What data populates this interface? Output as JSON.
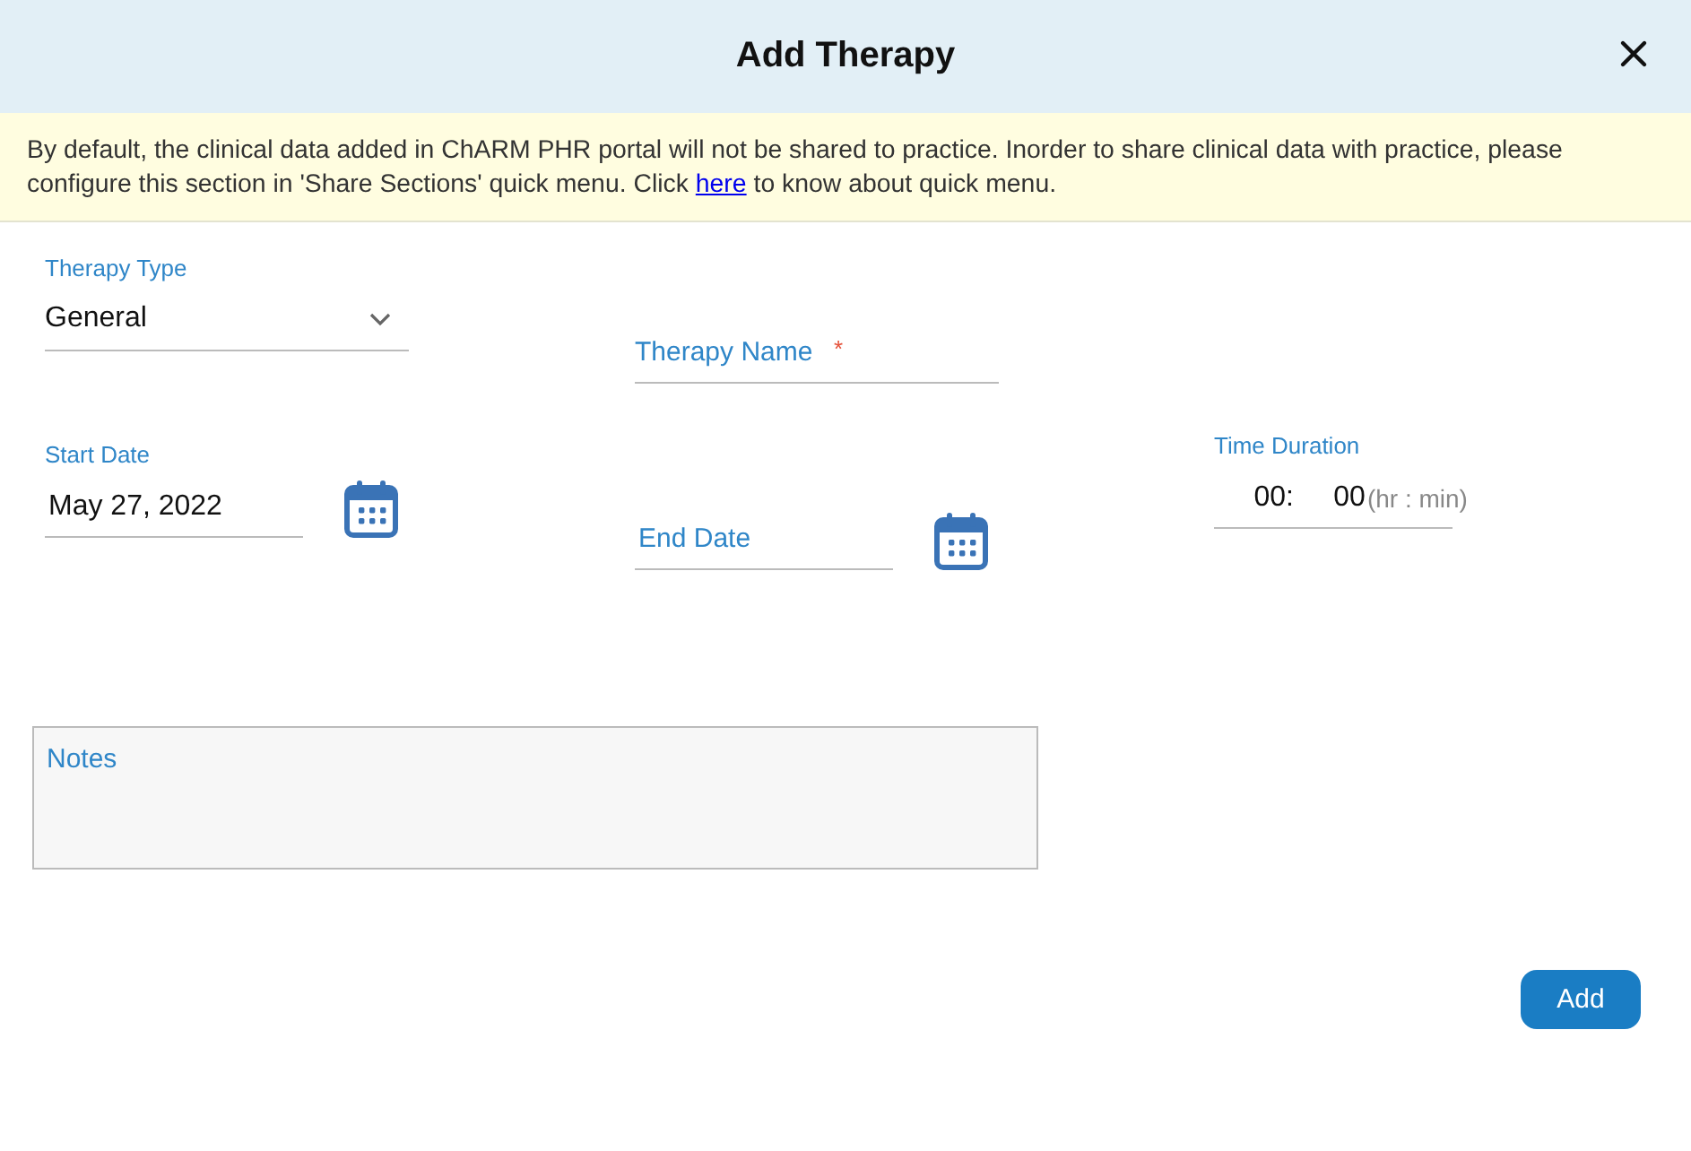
{
  "dialog": {
    "title": "Add Therapy"
  },
  "notice": {
    "text_before": "By default, the clinical data added in ChARM PHR portal will not be shared to practice. Inorder to share clinical data with practice, please configure this section in 'Share Sections' quick menu. Click ",
    "link": "here",
    "text_after": " to know about quick menu."
  },
  "therapy_type": {
    "label": "Therapy Type",
    "value": "General"
  },
  "therapy_name": {
    "placeholder": "Therapy Name",
    "required_mark": "*"
  },
  "start_date": {
    "label": "Start Date",
    "value": "May 27, 2022"
  },
  "end_date": {
    "placeholder": "End Date"
  },
  "time_duration": {
    "label": "Time Duration",
    "hours": "00",
    "separator": ":",
    "minutes": "00",
    "unit": "(hr : min)"
  },
  "notes": {
    "placeholder": "Notes"
  },
  "buttons": [
    {
      "label": "Add",
      "kind": "primary"
    }
  ]
}
